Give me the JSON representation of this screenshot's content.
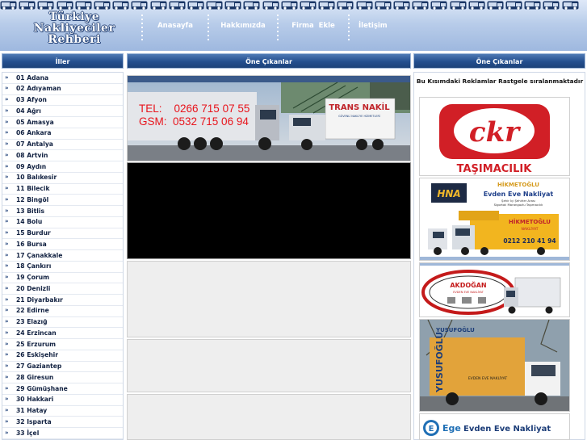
{
  "header": {
    "logo_line1": "Türkiye",
    "logo_line2": "Nakliyeciler",
    "logo_line3": "Rehberi"
  },
  "nav": {
    "home": "Anasayfa",
    "about": "Hakkımızda",
    "add_company": "Firma  Ekle",
    "contact": "İletişim"
  },
  "left_column": {
    "title": "İller",
    "cities": [
      "01 Adana",
      "02 Adıyaman",
      "03 Afyon",
      "04 Ağrı",
      "05 Amasya",
      "06 Ankara",
      "07 Antalya",
      "08 Artvin",
      "09 Aydın",
      "10 Balıkesir",
      "11 Bilecik",
      "12 Bingöl",
      "13 Bitlis",
      "14 Bolu",
      "15 Burdur",
      "16 Bursa",
      "17 Çanakkale",
      "18 Çankırı",
      "19 Çorum",
      "20 Denizli",
      "21 Diyarbakır",
      "22 Edirne",
      "23 Elazığ",
      "24 Erzincan",
      "25 Erzurum",
      "26 Eskişehir",
      "27 Gaziantep",
      "28 Giresun",
      "29 Gümüşhane",
      "30 Hakkari",
      "31 Hatay",
      "32 Isparta",
      "33 İçel"
    ]
  },
  "middle_column": {
    "title": "Öne Çıkanlar",
    "featured_1": {
      "phone_line": "TEL:    0266 715 07 55",
      "gsm_line": "GSM:  0532 715 06 94",
      "truck_brand": "TRANS NAKİL",
      "truck_sub": "GÜVENLİ NAKLİYE HİZMETLERİ"
    }
  },
  "right_column": {
    "title": "Öne Çıkanlar",
    "rotation_note": "Bu Kısımdaki Reklamlar Rastgele sıralanmaktadır",
    "ads": {
      "ckr_logo": "ckr",
      "ckr_name": "TAŞIMACILIK",
      "hikmetoglu_title": "HİKMETOĞLU",
      "hikmetoglu_sub": "Evden Eve Nakliyat",
      "hikmetoglu_tag1": "Şehir İçi Şehirler Arası",
      "hikmetoglu_tag2": "Sigortalı Marangozlu Taşımacılık",
      "hikmetoglu_truck": "HİKMETOĞLU",
      "hikmetoglu_truck_sub": "NAKLİYAT",
      "hikmetoglu_phone": "0212 210 41 94",
      "hna_logo": "HNA",
      "akdogan_name": "AKDOĞAN",
      "akdogan_sub": "EVDEN EVE NAKLİYAT",
      "yusufoglu_name": "YUSUFOĞLU",
      "yusufoglu_sub": "EVDEN EVE NAKLİYAT",
      "ege_logo": "E",
      "ege_name": "Ege",
      "ege_rest": "Evden Eve Nakliyat"
    }
  },
  "colors": {
    "header_bg": "#b9cdea",
    "column_header": "#244f8e",
    "nav_text": "#ffffff",
    "ckr_red": "#d11f26",
    "akdogan_red": "#c41a1a",
    "ege_blue": "#1f6fb5"
  },
  "icons": [
    "truck-icon",
    "double-chevron-right-icon"
  ]
}
